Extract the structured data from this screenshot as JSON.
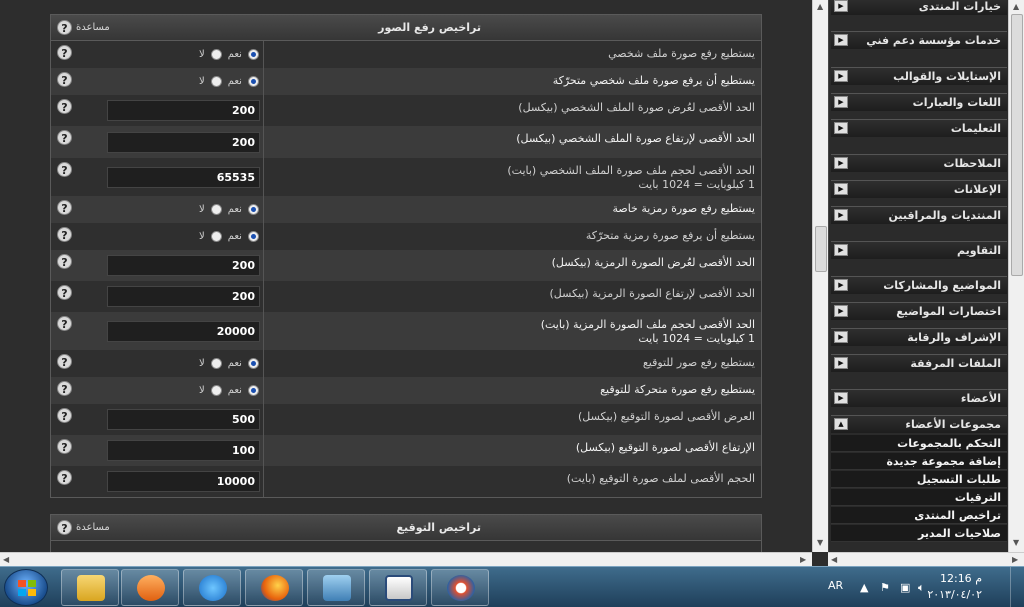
{
  "panel1": {
    "title": "تراخيص رفع الصور",
    "help_label": "مساعدة",
    "radio_yes": "نعم",
    "radio_no": "لا",
    "rows": [
      {
        "label": "يستطيع رفع صورة ملف شخصي",
        "type": "radio",
        "value": "yes"
      },
      {
        "label": "يستطيع أن يرفع صورة ملف شخصي متحرّكة",
        "type": "radio",
        "value": "yes"
      },
      {
        "label": "الحد الأقصى لعُرض صورة الملف الشخصي (بيكسل)",
        "type": "input",
        "value": "200"
      },
      {
        "label": "الحد الأقصى لإرتفاع صورة الملف الشخصي (بيكسل)",
        "type": "input",
        "value": "200"
      },
      {
        "label": "الحد الأقصى لحجم ملف صورة الملف الشخصي (بايت)",
        "sublabel": "1 كيلوبايت = 1024 بايت",
        "type": "input",
        "value": "65535"
      },
      {
        "label": "يستطيع رفع صورة رمزية خاصة",
        "type": "radio",
        "value": "yes"
      },
      {
        "label": "يستطيع أن يرفع صورة رمزية متحرّكة",
        "type": "radio",
        "value": "yes"
      },
      {
        "label": "الحد الأقصى لعُرض الصورة الرمزية (بيكسل)",
        "type": "input",
        "value": "200"
      },
      {
        "label": "الحد الأقصى لإرتفاع الصورة الرمزية (بيكسل)",
        "type": "input",
        "value": "200"
      },
      {
        "label": "الحد الأقصى لحجم ملف الصورة الرمزية (بايت)",
        "sublabel": "1 كيلوبايت = 1024 بايت",
        "type": "input",
        "value": "20000"
      },
      {
        "label": "يستطيع رفع صور للتوقيع",
        "type": "radio",
        "value": "yes"
      },
      {
        "label": "يستطيع رفع صورة متحركة للتوقيع",
        "type": "radio",
        "value": "yes"
      },
      {
        "label": "العرض الأقصى لصورة التوقيع (بيكسل)",
        "type": "input",
        "value": "500"
      },
      {
        "label": "الإرتفاع الأقصى لصورة التوقيع (بيكسل)",
        "type": "input",
        "value": "100"
      },
      {
        "label": "الحجم الأقصى لملف صورة التوقيع (بايت)",
        "type": "input",
        "value": "10000"
      }
    ]
  },
  "panel2": {
    "title": "تراخيص التوقيع",
    "help_label": "مساعدة"
  },
  "sidebar": {
    "items": [
      {
        "label": "خيارات المنتدى"
      },
      {
        "label": "خدمات مؤسسة دعم فني"
      },
      {
        "label": "الإستايلات والقوالب"
      },
      {
        "label": "اللغات والعبارات"
      },
      {
        "label": "التعليمات"
      },
      {
        "label": "الملاحظات"
      },
      {
        "label": "الإعلانات"
      },
      {
        "label": "المنتديات والمراقبين"
      },
      {
        "label": "التقاويم"
      },
      {
        "label": "المواضيع والمشاركات"
      },
      {
        "label": "اختصارات المواضيع"
      },
      {
        "label": "الإشراف والرقابة"
      },
      {
        "label": "الملفات المرفقة"
      },
      {
        "label": "الأعضاء"
      },
      {
        "label": "مجموعات الأعضاء"
      }
    ],
    "subitems": [
      {
        "label": "التحكم بالمجموعات"
      },
      {
        "label": "إضافة مجموعة جديدة"
      },
      {
        "label": "طلبات التسجيل"
      },
      {
        "label": "الترقيات"
      },
      {
        "label": "تراخيص المنتدى"
      },
      {
        "label": "صلاحيات المدير"
      }
    ]
  },
  "taskbar": {
    "language": "AR",
    "time": "12:16 م",
    "date": "٢٠١٣/٠٤/٠٢"
  },
  "colors": {
    "panel_bg": "#2f2f2f",
    "row_alt": "#3b3b3b",
    "taskbar": "#2f5574",
    "radio_dot": "#1a4fb0"
  }
}
